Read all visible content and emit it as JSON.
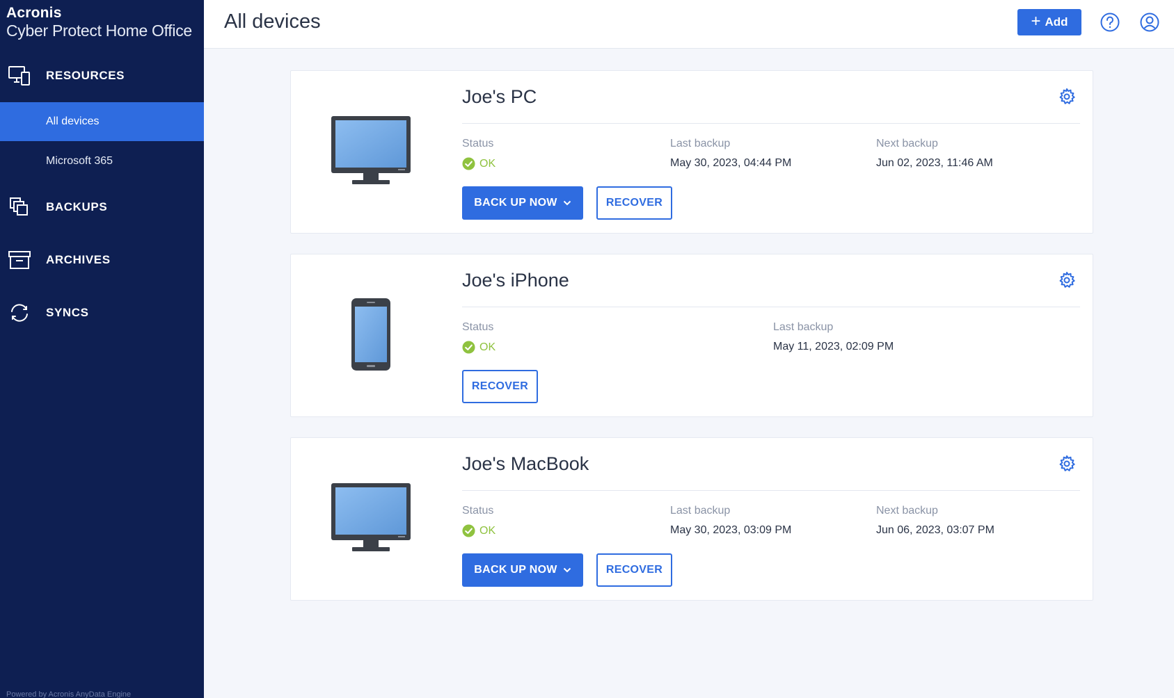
{
  "app": {
    "brand_line1": "Acronis",
    "brand_line2": "Cyber Protect Home Office",
    "footer": "Powered by Acronis AnyData Engine"
  },
  "sidebar": {
    "resources": {
      "label": "RESOURCES",
      "icon": "devices-icon"
    },
    "sub_items": [
      {
        "label": "All devices",
        "active": true
      },
      {
        "label": "Microsoft 365",
        "active": false
      }
    ],
    "backups": {
      "label": "BACKUPS",
      "icon": "backups-icon"
    },
    "archives": {
      "label": "ARCHIVES",
      "icon": "archive-box-icon"
    },
    "syncs": {
      "label": "SYNCS",
      "icon": "sync-icon"
    }
  },
  "header": {
    "title": "All devices",
    "add_label": "Add",
    "help_icon": "help-icon",
    "account_icon": "account-icon"
  },
  "devices": [
    {
      "name": "Joe's PC",
      "type": "monitor",
      "status_label": "Status",
      "status_value": "OK",
      "last_backup_label": "Last backup",
      "last_backup_value": "May 30, 2023, 04:44 PM",
      "next_backup_label": "Next backup",
      "next_backup_value": "Jun 02, 2023, 11:46 AM",
      "backup_now_label": "BACK UP NOW",
      "recover_label": "RECOVER"
    },
    {
      "name": "Joe's iPhone",
      "type": "phone",
      "status_label": "Status",
      "status_value": "OK",
      "last_backup_label": "Last backup",
      "last_backup_value": "May 11, 2023, 02:09 PM",
      "recover_label": "RECOVER"
    },
    {
      "name": "Joe's MacBook",
      "type": "monitor",
      "status_label": "Status",
      "status_value": "OK",
      "last_backup_label": "Last backup",
      "last_backup_value": "May 30, 2023, 03:09 PM",
      "next_backup_label": "Next backup",
      "next_backup_value": "Jun 06, 2023, 03:07 PM",
      "backup_now_label": "BACK UP NOW",
      "recover_label": "RECOVER"
    }
  ],
  "colors": {
    "sidebar_bg": "#0e1f52",
    "accent": "#2f6ce0",
    "ok": "#8fc23f"
  }
}
